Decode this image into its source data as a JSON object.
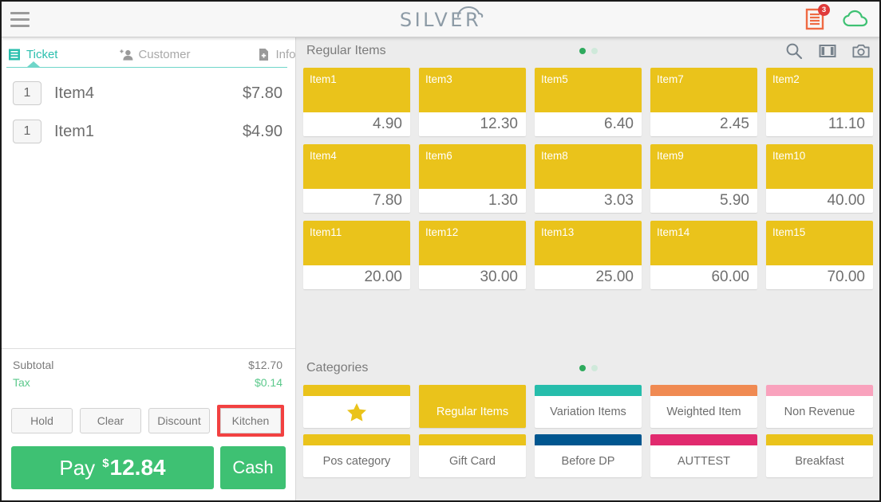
{
  "header": {
    "logo_text": "SILVER",
    "menu_icon": "hamburger-icon",
    "receipt_badge": "3",
    "receipt_icon": "receipt-icon",
    "cloud_icon": "cloud-icon"
  },
  "ticket": {
    "tabs": [
      {
        "label": "Ticket",
        "icon": "list-icon",
        "active": true
      },
      {
        "label": "Customer",
        "icon": "add-person-icon",
        "active": false
      },
      {
        "label": "Info",
        "icon": "add-document-icon",
        "active": false
      }
    ],
    "lines": [
      {
        "qty": "1",
        "name": "Item4",
        "price": "$7.80"
      },
      {
        "qty": "1",
        "name": "Item1",
        "price": "$4.90"
      }
    ],
    "totals": [
      {
        "label": "Subtotal",
        "value": "$12.70"
      },
      {
        "label": "Tax",
        "value": "$0.14"
      }
    ],
    "actions": [
      {
        "label": "Hold"
      },
      {
        "label": "Clear"
      },
      {
        "label": "Discount"
      },
      {
        "label": "Kitchen",
        "highlighted": true
      }
    ],
    "pay_label": "Pay",
    "pay_currency": "$",
    "pay_amount": "12.84",
    "cash_label": "Cash"
  },
  "items_section": {
    "title": "Regular Items",
    "pages": {
      "count": 2,
      "active": 0
    },
    "icons": [
      "search-icon",
      "layout-columns-icon",
      "camera-icon"
    ],
    "tiles": [
      {
        "name": "Item1",
        "price": "4.90"
      },
      {
        "name": "Item3",
        "price": "12.30"
      },
      {
        "name": "Item5",
        "price": "6.40"
      },
      {
        "name": "Item7",
        "price": "2.45"
      },
      {
        "name": "Item2",
        "price": "11.10"
      },
      {
        "name": "Item4",
        "price": "7.80"
      },
      {
        "name": "Item6",
        "price": "1.30"
      },
      {
        "name": "Item8",
        "price": "3.03"
      },
      {
        "name": "Item9",
        "price": "5.90"
      },
      {
        "name": "Item10",
        "price": "40.00"
      },
      {
        "name": "Item11",
        "price": "20.00"
      },
      {
        "name": "Item12",
        "price": "30.00"
      },
      {
        "name": "Item13",
        "price": "25.00"
      },
      {
        "name": "Item14",
        "price": "60.00"
      },
      {
        "name": "Item15",
        "price": "70.00"
      }
    ]
  },
  "categories_section": {
    "title": "Categories",
    "pages": {
      "count": 2,
      "active": 0
    },
    "tiles": [
      {
        "label": "",
        "color": "#eac31b",
        "icon": "star-icon",
        "selected": false
      },
      {
        "label": "Regular Items",
        "color": "#eac31b",
        "selected": true
      },
      {
        "label": "Variation Items",
        "color": "#26bdab",
        "selected": false
      },
      {
        "label": "Weighted Item",
        "color": "#f08a52",
        "selected": false
      },
      {
        "label": "Non Revenue",
        "color": "#f9a2bd",
        "selected": false
      },
      {
        "label": "Pos category",
        "color": "#eac31b",
        "selected": false
      },
      {
        "label": "Gift Card",
        "color": "#eac31b",
        "selected": false
      },
      {
        "label": "Before DP",
        "color": "#00568f",
        "selected": false
      },
      {
        "label": "AUTTEST",
        "color": "#e12a6e",
        "selected": false
      },
      {
        "label": "Breakfast",
        "color": "#eac31b",
        "selected": false
      }
    ]
  },
  "colors": {
    "accent_teal": "#2bbfae",
    "accent_green": "#3ec173",
    "tile_yellow": "#eac31b",
    "highlight_red": "#f24141",
    "badge_red": "#e03b3b",
    "receipt_orange": "#ef6a43"
  }
}
